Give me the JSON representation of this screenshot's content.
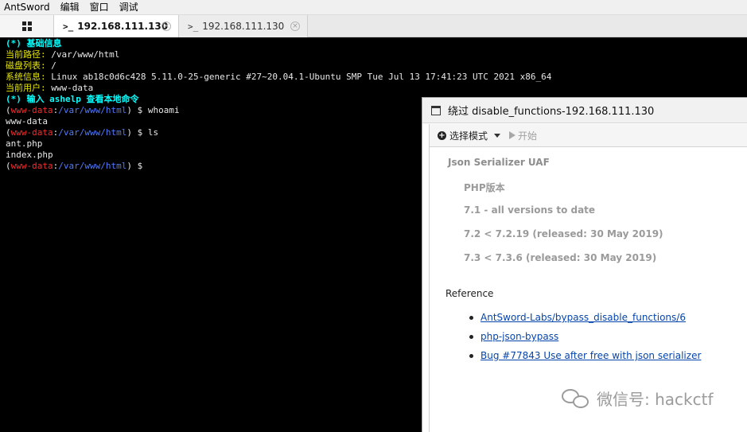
{
  "menubar": {
    "items": [
      "AntSword",
      "编辑",
      "窗口",
      "调试"
    ]
  },
  "tabs": [
    {
      "prompt": ">_",
      "label": "192.168.111.130",
      "active": true
    },
    {
      "prompt": ">_",
      "label": "192.168.111.130",
      "active": false
    }
  ],
  "terminal": {
    "basic_info_header": "(*) 基础信息",
    "path_label": "当前路径:",
    "path_value": " /var/www/html",
    "disk_label": "磁盘列表:",
    "disk_value": " /",
    "system_label": "系统信息:",
    "system_value": " Linux ab18c0d6c428 5.11.0-25-generic #27~20.04.1-Ubuntu SMP Tue Jul 13 17:41:23 UTC 2021 x86_64",
    "user_label": "当前用户:",
    "user_value": " www-data",
    "help_line": "(*) 输入 ashelp 查看本地命令",
    "prompt_open": "(",
    "prompt_user": "www-data",
    "prompt_colon": ":",
    "prompt_path": "/var/www/html",
    "prompt_close": ") $ ",
    "cmd1": "whoami",
    "out1": "www-data",
    "cmd2": "ls",
    "out2a": "ant.php",
    "out2b": "index.php"
  },
  "dialog": {
    "title": "绕过 disable_functions-192.168.111.130",
    "toolbar": {
      "mode_label": "选择模式",
      "start_label": "开始"
    },
    "content": {
      "heading": "Json Serializer UAF",
      "php_version_label": "PHP版本",
      "versions": [
        "7.1 - all versions to date",
        "7.2 < 7.2.19 (released: 30 May 2019)",
        "7.3 < 7.3.6 (released: 30 May 2019)"
      ],
      "reference_label": "Reference",
      "references": [
        "AntSword-Labs/bypass_disable_functions/6",
        "php-json-bypass",
        "Bug #77843 Use after free with json serializer"
      ]
    }
  },
  "watermark": {
    "text": "微信号: hackctf"
  },
  "colors": {
    "terminal_bg": "#000000",
    "header_cyan": "#00ffff",
    "label_yellow": "#e6e600",
    "prompt_red": "#ff2a2a",
    "prompt_blue": "#4d7bff",
    "link_blue": "#0645ad"
  }
}
